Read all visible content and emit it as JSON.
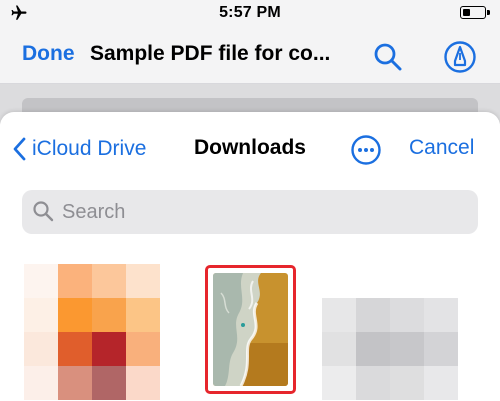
{
  "status_bar": {
    "time": "5:57 PM",
    "battery_level": 0.35,
    "icons": [
      "airplane-icon",
      "battery-icon"
    ]
  },
  "viewer": {
    "done_label": "Done",
    "document_title": "Sample PDF file for co...",
    "icons": [
      "search-icon",
      "markup-icon"
    ]
  },
  "picker": {
    "back_label": "iCloud Drive",
    "title": "Downloads",
    "cancel_label": "Cancel",
    "more_icon": "ellipsis-circle-icon",
    "search": {
      "placeholder": "Search"
    }
  },
  "files": [
    {
      "kind": "image",
      "thumbnail": "pixelated-orange",
      "selected": false
    },
    {
      "kind": "image",
      "thumbnail": "beach-aerial",
      "selected": true
    },
    {
      "kind": "image",
      "thumbnail": "pixelated-grey",
      "selected": false
    }
  ],
  "colors": {
    "accent": "#1b6fe0",
    "selection_border": "#e6262c"
  }
}
